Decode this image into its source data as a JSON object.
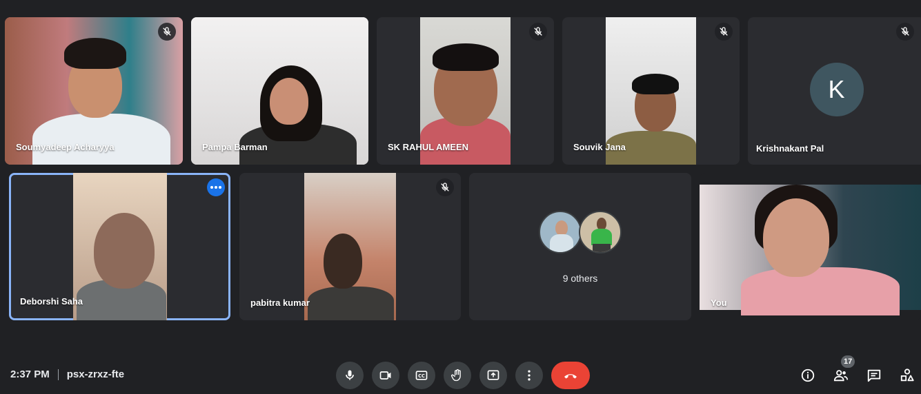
{
  "participants": [
    {
      "name": "Soumyadeep Acharyya",
      "muted": true
    },
    {
      "name": "Pampa Barman",
      "muted": false
    },
    {
      "name": "SK RAHUL AMEEN",
      "muted": true
    },
    {
      "name": "Souvik Jana",
      "muted": true
    },
    {
      "name": "Krishnakant Pal",
      "muted": true,
      "avatar_letter": "K"
    },
    {
      "name": "Deborshi Saha",
      "muted": false,
      "selected": true
    },
    {
      "name": "pabitra kumar",
      "muted": true
    },
    {
      "name": "You",
      "muted": false
    }
  ],
  "others": {
    "label": "9 others"
  },
  "meeting": {
    "time": "2:37 PM",
    "code": "psx-zrxz-fte"
  },
  "controls": [
    "mic-icon",
    "camera-icon",
    "captions-icon",
    "raise-hand-icon",
    "present-icon",
    "more-options-icon",
    "end-call-icon"
  ],
  "side_controls": {
    "people_count": "17"
  },
  "colors": {
    "background": "#202124",
    "tile": "#3c4043",
    "accent": "#8ab4f8",
    "end_call": "#ea4335"
  }
}
